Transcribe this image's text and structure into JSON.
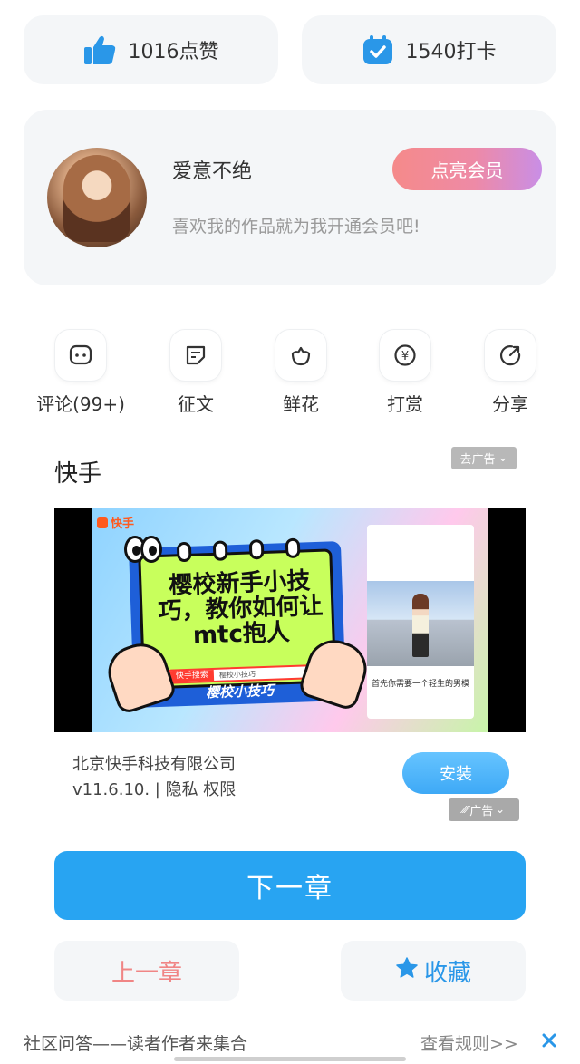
{
  "stats": {
    "likes_label": "1016点赞",
    "checkins_label": "1540打卡"
  },
  "author": {
    "name": "爱意不绝",
    "description": "喜欢我的作品就为我开通会员吧!",
    "vip_button": "点亮会员"
  },
  "actions": [
    {
      "label": "评论(99+)",
      "icon": "comment-icon"
    },
    {
      "label": "征文",
      "icon": "essay-icon"
    },
    {
      "label": "鲜花",
      "icon": "flower-icon"
    },
    {
      "label": "打赏",
      "icon": "reward-yen-icon"
    },
    {
      "label": "分享",
      "icon": "share-icon"
    }
  ],
  "ad": {
    "title": "快手",
    "remove_ad_label": "去广告",
    "video": {
      "brand": "快手",
      "headline": "樱校新手小技巧，教你如何让mtc抱人",
      "search_label": "快手搜索",
      "search_query": "樱校小技巧",
      "footer": "樱校小技巧",
      "phone_caption": "首先你需要一个轻生的男模"
    },
    "company": "北京快手科技有限公司",
    "meta": "v11.6.10. | 隐私  权限",
    "install_button": "安装",
    "ad_badge": "广告"
  },
  "navigation": {
    "next_chapter": "下一章",
    "prev_chapter": "上一章",
    "favorite": "收藏"
  },
  "footer": {
    "community": "社区问答——读者作者来集合",
    "rules_link": "查看规则>>"
  },
  "colors": {
    "primary_blue": "#28a4f2",
    "prev_red": "#f08585",
    "card_bg": "#f4f6f8"
  }
}
